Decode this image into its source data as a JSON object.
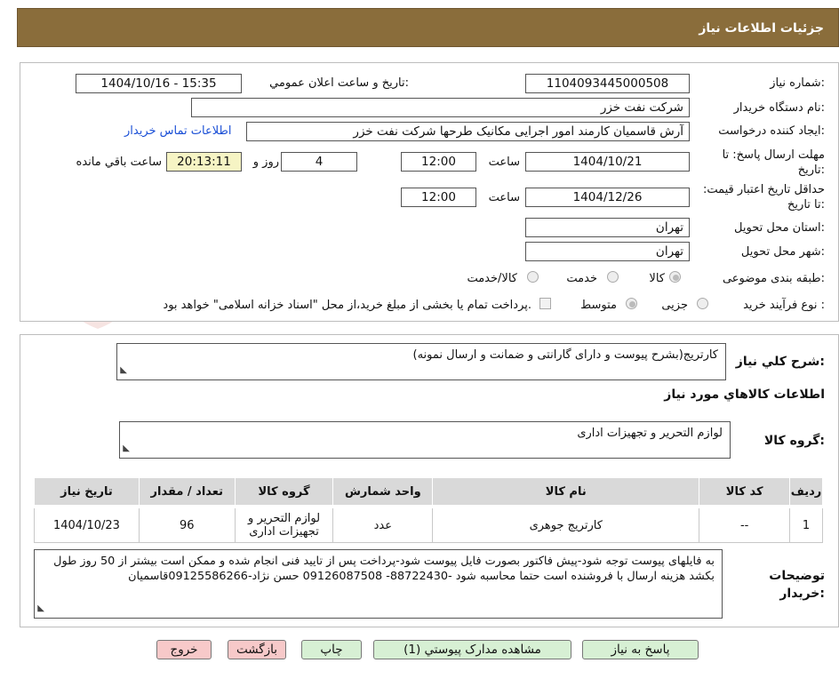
{
  "header": {
    "title": "جزئیات اطلاعات نیاز"
  },
  "watermark": {
    "text": "AriaTender.neT"
  },
  "form": {
    "need_number_label": "شماره نیاز:",
    "need_number": "1104093445000508",
    "announce_label": "تاریخ و ساعت اعلان عمومي:",
    "announce_value": "1404/10/16 - 15:35",
    "buyer_org_label": "نام دستگاه خریدار:",
    "buyer_org": "شرکت نفت خزر",
    "requester_label": "ایجاد کننده درخواست:",
    "requester": "آرش قاسمیان کارمند امور اجرایی مکانیک طرحها شرکت نفت خزر",
    "contact_link": "اطلاعات تماس خریدار",
    "deadline_label": "مهلت ارسال پاسخ: تا تاریخ:",
    "deadline_date": "1404/10/21",
    "time_label": "ساعت",
    "deadline_time": "12:00",
    "days_value": "4",
    "days_label": "روز و",
    "remaining_time": "20:13:11",
    "remaining_label": "ساعت باقي مانده",
    "validity_label": "حداقل تاریخ اعتبار قیمت: تا تاریخ:",
    "validity_date": "1404/12/26",
    "validity_time": "12:00",
    "province_label": "استان محل تحویل:",
    "province": "تهران",
    "city_label": "شهر محل تحویل:",
    "city": "تهران",
    "category_label": "طبقه بندی موضوعی:",
    "category_options": [
      "کالا",
      "خدمت",
      "کالا/خدمت"
    ],
    "process_label": "نوع فرآیند خرید :",
    "process_options": [
      "جزیی",
      "متوسط"
    ],
    "process_note": "پرداخت تمام یا بخشی از مبلغ خرید،از محل \"اسناد خزانه اسلامی\" خواهد بود."
  },
  "description": {
    "label": "شرح کلي نیاز:",
    "text": "کارتریج(بشرح پیوست و دارای گارانتی و ضمانت و ارسال نمونه)",
    "items_title": "اطلاعات کالاهاي مورد نیاز",
    "group_label": "گروه کالا:",
    "group_value": "لوازم التحریر و تجهیزات اداری"
  },
  "table": {
    "headers": [
      "ردیف",
      "کد کالا",
      "نام کالا",
      "واحد شمارش",
      "گروه کالا",
      "تعداد / مقدار",
      "تاریخ نیاز"
    ],
    "rows": [
      [
        "1",
        "--",
        "کارتریج جوهری",
        "عدد",
        "لوازم التحریر و تجهیزات اداری",
        "96",
        "1404/10/23"
      ]
    ]
  },
  "notes": {
    "label": "توضیحات خریدار:",
    "text": "به فایلهای پیوست توجه شود-پیش فاکتور بصورت فایل پیوست شود-پرداخت پس از تایید فنی انجام شده و ممکن است بیشتر از 50 روز طول بکشد هزینه ارسال با فروشنده است حتما محاسبه شود -88722430- 09126087508 حسن نژاد-09125586266قاسمیان"
  },
  "buttons": {
    "reply": "پاسخ به نیاز",
    "attachments": "مشاهده مدارک پیوستي (1)",
    "print": "چاپ",
    "back": "بازگشت",
    "exit": "خروج"
  },
  "colors": {
    "header_bg": "#8a6d3b",
    "green_btn": "#d7f0d4",
    "pink_btn": "#f7c9c9",
    "link": "#1a4fd6"
  }
}
